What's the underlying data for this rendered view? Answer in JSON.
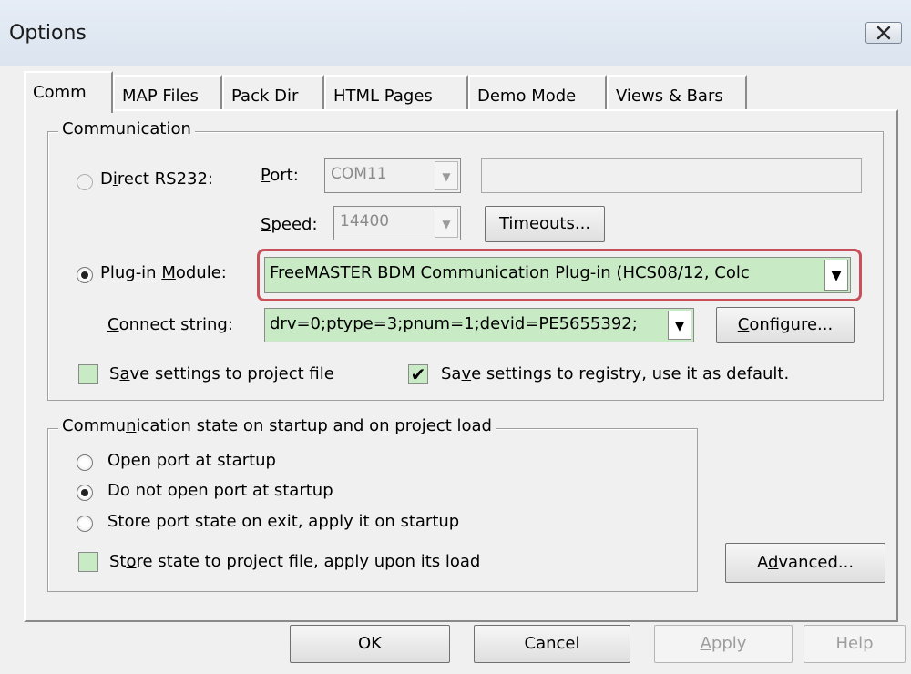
{
  "window": {
    "title": "Options",
    "close_icon": "close-icon"
  },
  "tabs": [
    "Comm",
    "MAP Files",
    "Pack Dir",
    "HTML Pages",
    "Demo Mode",
    "Views & Bars"
  ],
  "communication": {
    "legend": "Communication",
    "direct_rs232": {
      "label_pre": "D",
      "label_u": "i",
      "label_post": "rect RS232:",
      "port_label_u": "P",
      "port_label_post": "ort:",
      "port_value": "COM11",
      "port_text": "",
      "speed_label_u": "S",
      "speed_label_post": "peed:",
      "speed_value": "14400",
      "timeouts_u": "T",
      "timeouts_post": "imeouts..."
    },
    "plugin": {
      "label_pre": "Plug-in ",
      "label_u": "M",
      "label_post": "odule:",
      "value": "FreeMASTER BDM Communication Plug-in (HCS08/12, Colc",
      "connect_label_u": "C",
      "connect_label_post": "onnect string:",
      "connect_value": "drv=0;ptype=3;pnum=1;devid=PE5655392;",
      "configure_u": "C",
      "configure_post": "onfigure..."
    },
    "save_project": {
      "pre": "S",
      "u": "a",
      "post": "ve settings to project file",
      "checked": false
    },
    "save_registry": {
      "pre": "Sa",
      "u": "v",
      "post": "e settings to registry, use it as default.",
      "checked": true
    }
  },
  "startup": {
    "legend_pre": "Commu",
    "legend_u": "n",
    "legend_post": "ication state on startup and on project load",
    "options": [
      "Open port at startup",
      "Do not open port at startup",
      "Store port state on exit, apply it on startup"
    ],
    "selected_index": 1,
    "store_state": {
      "pre": "St",
      "u": "o",
      "post": "re state to project file, apply upon its load",
      "checked": false
    },
    "advanced_pre": "A",
    "advanced_u": "d",
    "advanced_post": "vanced..."
  },
  "buttons": {
    "ok": "OK",
    "cancel": "Cancel",
    "apply_u": "A",
    "apply_post": "pply",
    "help": "Help"
  }
}
